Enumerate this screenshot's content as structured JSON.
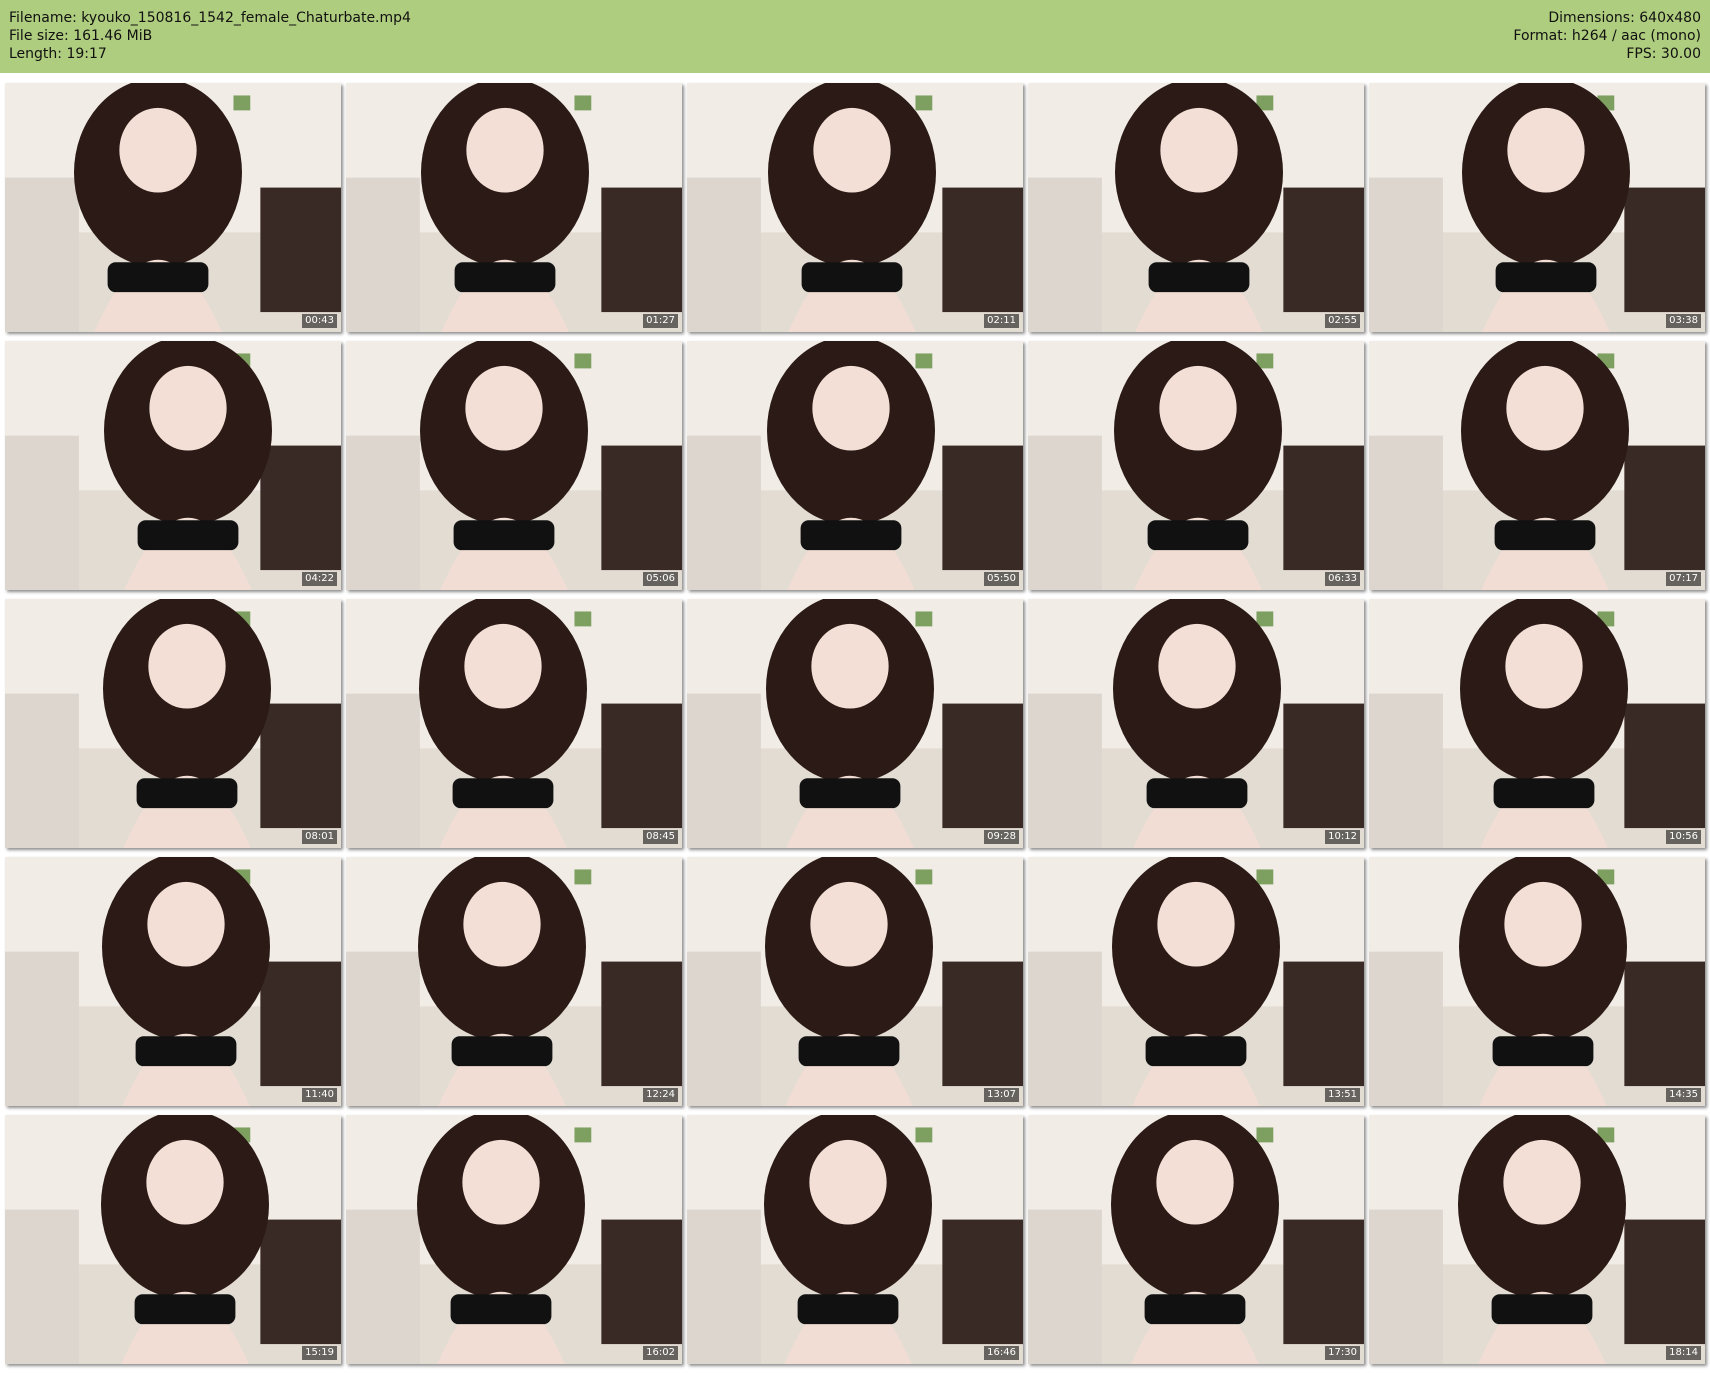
{
  "header": {
    "background": "#afcd7e",
    "filename": "Filename: kyouko_150816_1542_female_Chaturbate.mp4",
    "file_size": "File size: 161.46 MiB",
    "length": "Length: 19:17",
    "dimensions": "Dimensions: 640x480",
    "format": "Format: h264 / aac (mono)",
    "fps": "FPS: 30.00"
  },
  "thumbnails": [
    {
      "timestamp": "00:43"
    },
    {
      "timestamp": "01:27"
    },
    {
      "timestamp": "02:11"
    },
    {
      "timestamp": "02:55"
    },
    {
      "timestamp": "03:38"
    },
    {
      "timestamp": "04:22"
    },
    {
      "timestamp": "05:06"
    },
    {
      "timestamp": "05:50"
    },
    {
      "timestamp": "06:33"
    },
    {
      "timestamp": "07:17"
    },
    {
      "timestamp": "08:01"
    },
    {
      "timestamp": "08:45"
    },
    {
      "timestamp": "09:28"
    },
    {
      "timestamp": "10:12"
    },
    {
      "timestamp": "10:56"
    },
    {
      "timestamp": "11:40"
    },
    {
      "timestamp": "12:24"
    },
    {
      "timestamp": "13:07"
    },
    {
      "timestamp": "13:51"
    },
    {
      "timestamp": "14:35"
    },
    {
      "timestamp": "15:19"
    },
    {
      "timestamp": "16:02"
    },
    {
      "timestamp": "16:46"
    },
    {
      "timestamp": "17:30"
    },
    {
      "timestamp": "18:14"
    }
  ]
}
